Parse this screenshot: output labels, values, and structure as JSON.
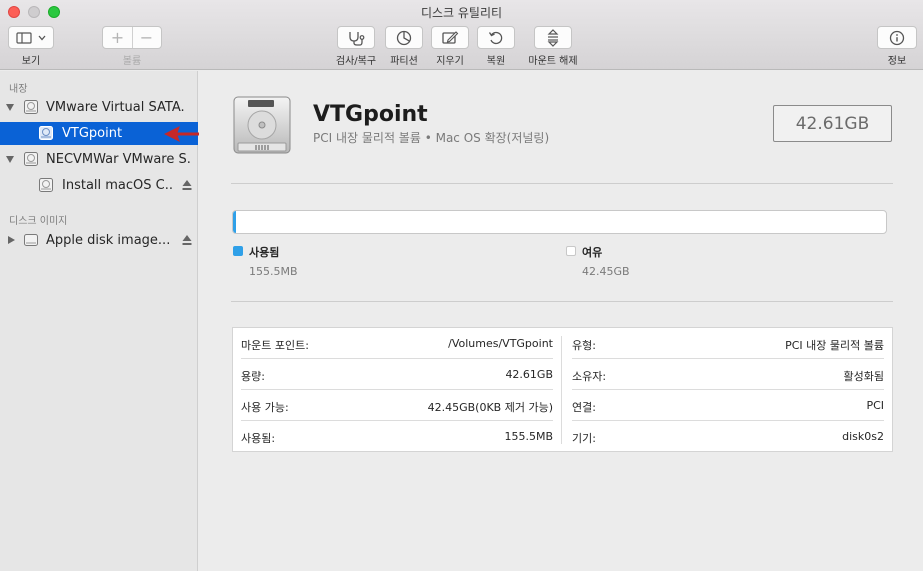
{
  "window": {
    "title": "디스크 유틸리티"
  },
  "toolbar": {
    "view_label": "보기",
    "volume_label": "볼륨",
    "firstaid_label": "검사/복구",
    "partition_label": "파티션",
    "erase_label": "지우기",
    "restore_label": "복원",
    "unmount_label": "마운트 해제",
    "info_label": "정보"
  },
  "sidebar": {
    "internal_header": "내장",
    "disk_images_header": "디스크 이미지",
    "items": [
      {
        "label": "VMware Virtual SATA...",
        "icon": "internal-disk-icon",
        "level": 0,
        "expanded": true
      },
      {
        "label": "VTGpoint",
        "icon": "volume-icon",
        "level": 1,
        "selected": true
      },
      {
        "label": "NECVMWar VMware S...",
        "icon": "internal-disk-icon",
        "level": 0,
        "expanded": true
      },
      {
        "label": "Install macOS C...",
        "icon": "volume-icon",
        "level": 1,
        "eject": true
      },
      {
        "label": "Apple disk image...",
        "icon": "disk-image-icon",
        "level": 0,
        "expanded": false,
        "eject": true
      }
    ]
  },
  "volume": {
    "name": "VTGpoint",
    "subtitle": "PCI 내장 물리적 볼륨 • Mac OS 확장(저널링)",
    "size": "42.61GB",
    "used_fraction": 0.0036
  },
  "usage": {
    "used_title": "사용됨",
    "used_value": "155.5MB",
    "used_color": "#2fa0e8",
    "free_title": "여유",
    "free_value": "42.45GB",
    "free_color": "#ffffff"
  },
  "info": {
    "left": [
      {
        "k": "마운트 포인트:",
        "v": "/Volumes/VTGpoint"
      },
      {
        "k": "용량:",
        "v": "42.61GB"
      },
      {
        "k": "사용 가능:",
        "v": "42.45GB(0KB 제거 가능)"
      },
      {
        "k": "사용됨:",
        "v": "155.5MB"
      }
    ],
    "right": [
      {
        "k": "유형:",
        "v": "PCI 내장 물리적 볼륨"
      },
      {
        "k": "소유자:",
        "v": "활성화됨"
      },
      {
        "k": "연결:",
        "v": "PCI"
      },
      {
        "k": "기기:",
        "v": "disk0s2"
      }
    ]
  },
  "colors": {
    "selection": "#0a62d6",
    "annotation_arrow": "#c62828"
  }
}
